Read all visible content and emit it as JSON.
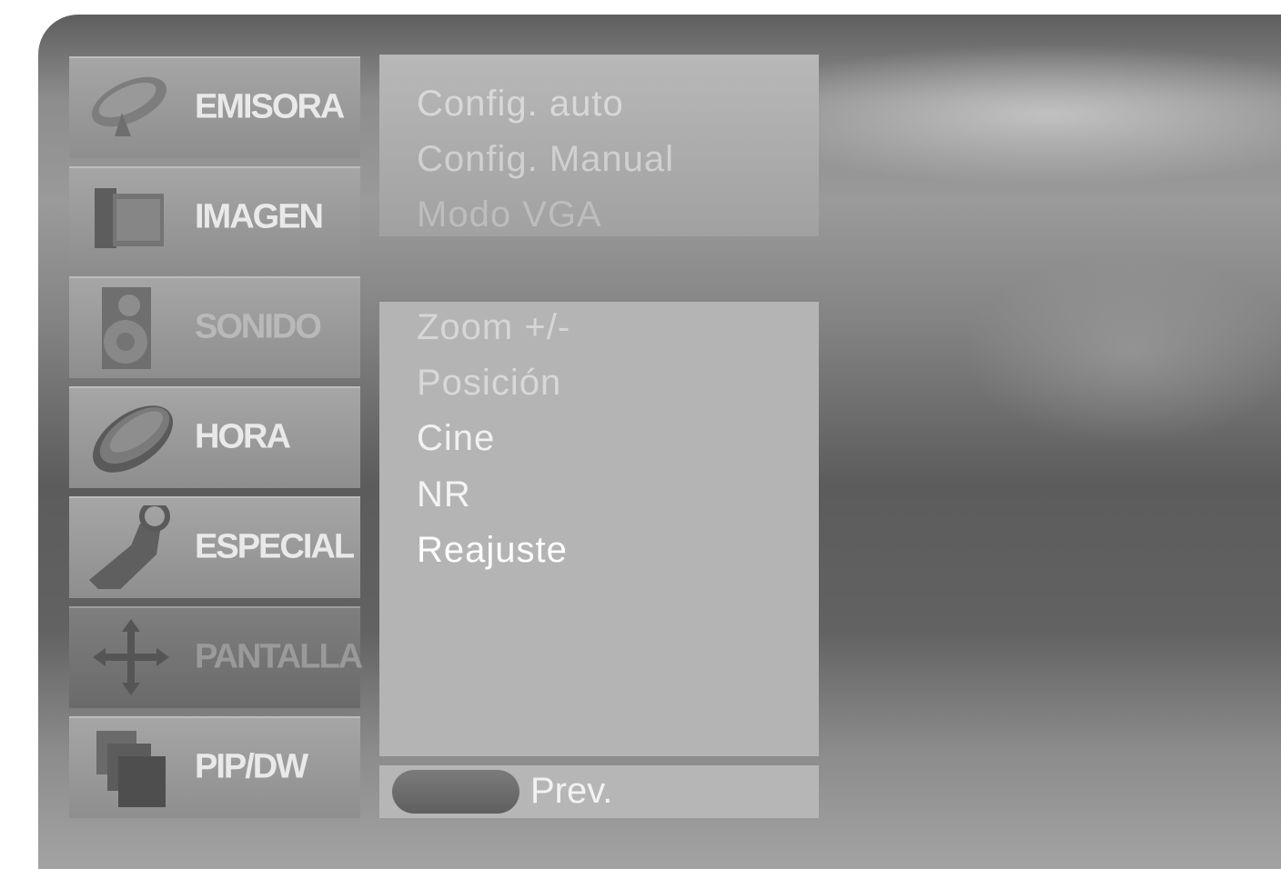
{
  "sidebar": {
    "items": [
      {
        "label": "EMISORA",
        "icon": "satellite-dish-icon"
      },
      {
        "label": "IMAGEN",
        "icon": "picture-icon"
      },
      {
        "label": "SONIDO",
        "icon": "speaker-icon"
      },
      {
        "label": "HORA",
        "icon": "clock-icon"
      },
      {
        "label": "ESPECIAL",
        "icon": "tag-icon"
      },
      {
        "label": "PANTALLA",
        "icon": "move-arrows-icon",
        "selected": true
      },
      {
        "label": "PIP/DW",
        "icon": "pip-windows-icon"
      }
    ]
  },
  "submenu_top": {
    "items": [
      "Config. auto",
      "Config. Manual",
      "Modo VGA"
    ]
  },
  "submenu_main": {
    "items": [
      "Zoom +/-",
      "Posición",
      "Cine",
      "NR",
      "Reajuste"
    ]
  },
  "footer": {
    "prev_label": "Prev."
  },
  "colors": {
    "panel": "#b4b4b4",
    "selected_item": "#6a6a6a",
    "text": "#ffffff"
  }
}
